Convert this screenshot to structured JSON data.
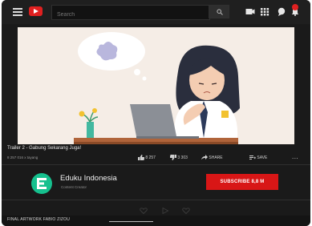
{
  "search": {
    "placeholder": "Search"
  },
  "video": {
    "title": "Trailer 2 - Gabung Sekarang Juga!",
    "views": "8 257 016 x tayang",
    "likes": "8 257",
    "dislikes": "3 303",
    "share_label": "SHARE",
    "save_label": "SAVE",
    "more_label": "..."
  },
  "channel": {
    "name": "Eduku Indonesia",
    "subtitle": "Content Creator",
    "subscribe_label": "SUBSCRIBE  8,8 M"
  },
  "footer": {
    "credit": "FINAL ARTWORK FABIO ZIZOU"
  },
  "colors": {
    "background": "#1a1a1a",
    "subscribe": "#d81616",
    "avatar": "#16c08e",
    "brand_red": "#e02020"
  }
}
